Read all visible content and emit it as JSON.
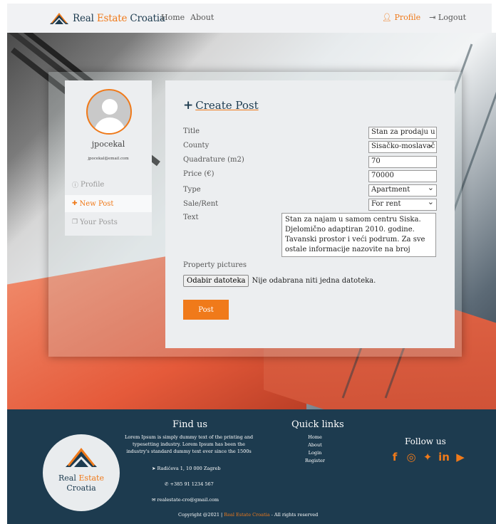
{
  "navbar": {
    "brand": {
      "part1": "Real ",
      "part2": "Estate",
      "part3": " Croatia"
    },
    "links": [
      "Home",
      "About"
    ],
    "profile_label": "Profile",
    "logout_label": "Logout"
  },
  "sidebar": {
    "username": "jpocekal",
    "email": "jpocekal@email.com",
    "items": [
      {
        "label": "Profile",
        "icon": "info-icon"
      },
      {
        "label": "New Post",
        "icon": "plus-icon"
      },
      {
        "label": "Your Posts",
        "icon": "copy-icon"
      }
    ]
  },
  "form": {
    "title": "Create Post",
    "fields": {
      "title": {
        "label": "Title",
        "value": "Stan za prodaju u Si"
      },
      "county": {
        "label": "County",
        "value": "Sisačko-moslavač"
      },
      "quadrature": {
        "label": "Quadrature (m2)",
        "value": "70"
      },
      "price": {
        "label": "Price (€)",
        "value": "70000"
      },
      "type": {
        "label": "Type",
        "value": "Apartment"
      },
      "sale_rent": {
        "label": "Sale/Rent",
        "value": "For rent"
      },
      "text": {
        "label": "Text",
        "value": "Stan za najam u samom centru Siska. Djelomično adaptiran 2010. godine. Tavanski prostor i veći podrum. Za sve ostale informacije nazovite na broj"
      }
    },
    "pictures_label": "Property pictures",
    "file_button": "Odabir datoteka",
    "file_status": "Nije odabrana niti jedna datoteka.",
    "submit": "Post"
  },
  "footer": {
    "logo": {
      "line1a": "Real ",
      "line1b": "Estate",
      "line2": "Croatia"
    },
    "find_us": "Find us",
    "lorem": "Lorem Ipsum is simply dummy text of the printing and typesetting industry. Lorem Ipsum has been the industry's standard dummy text ever since the 1500s",
    "address": "Radićeva 1, 10 000 Zagreb",
    "phone": "+385 91 1234 567",
    "email": "realestate-cro@gmail.com",
    "quick_links_title": "Quick links",
    "quick_links": [
      "Home",
      "About",
      "Login",
      "Register"
    ],
    "follow_us": "Follow us",
    "social": [
      "facebook-icon",
      "instagram-icon",
      "twitter-icon",
      "linkedin-icon",
      "youtube-icon"
    ],
    "copyright_prefix": "Copyright @2021 | ",
    "copyright_brand": "Real Estate Croatia",
    "copyright_suffix": " - All rights reserved"
  },
  "colors": {
    "accent": "#f07a1a",
    "navy": "#1d3b4f"
  }
}
